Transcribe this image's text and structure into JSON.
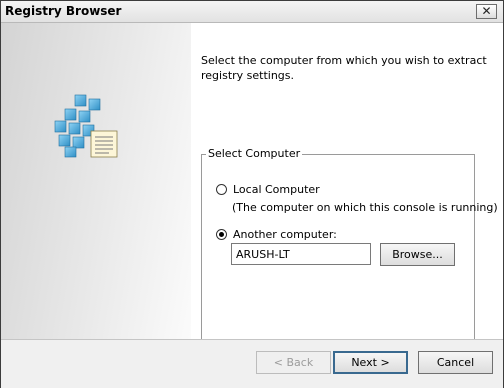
{
  "window": {
    "title": "Registry Browser",
    "close_symbol": "✕"
  },
  "description": "Select the computer from which you wish to extract registry settings.",
  "group": {
    "label": "Select Computer",
    "local": {
      "label": "Local Computer",
      "subtext": "(The computer on which this console is running)",
      "checked": false
    },
    "another": {
      "label": "Another computer:",
      "checked": true
    },
    "computer_name": "ARUSH-LT",
    "browse_label": "Browse..."
  },
  "buttons": {
    "back": "< Back",
    "next": "Next >",
    "cancel": "Cancel"
  },
  "icon": {
    "name": "registry-icon",
    "accent": "#4aa7d8"
  }
}
